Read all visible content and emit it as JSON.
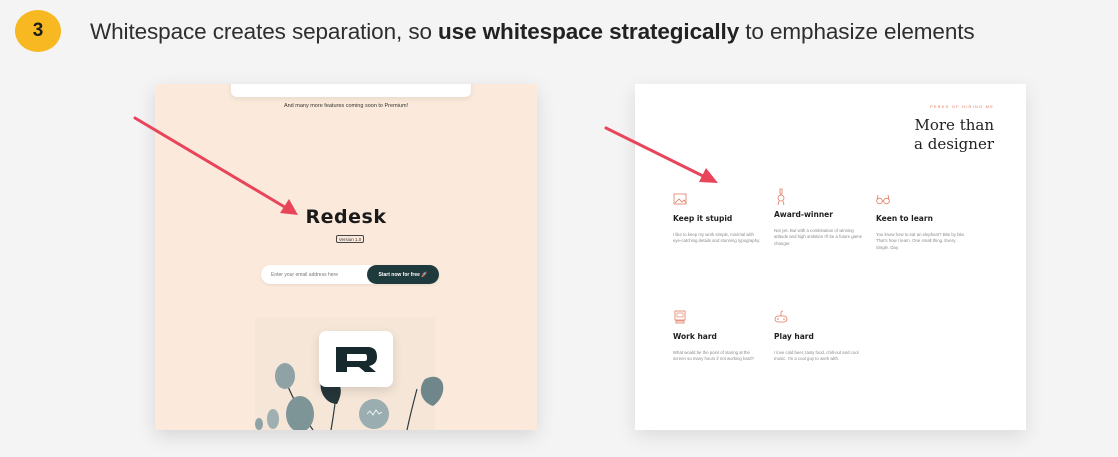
{
  "header": {
    "step_number": "3",
    "headline_prefix": "Whitespace creates separation, so ",
    "headline_bold": "use whitespace strategically",
    "headline_suffix": " to emphasize elements",
    "badge_color": "#f7b821"
  },
  "left_example": {
    "features_note": "And many more features coming soon to Premium!",
    "brand_name": "Redesk",
    "version": "Version 1.0",
    "email_placeholder": "Enter your email address here",
    "cta_label": "Start now for free 🚀",
    "background_color": "#fbeadb",
    "accent_color": "#1f3a3d"
  },
  "right_example": {
    "eyebrow": "PERKS OF HIRING ME",
    "heading_line1": "More than",
    "heading_line2": "a designer",
    "accent_color": "#e07a5f",
    "features": [
      {
        "icon": "image-icon",
        "title": "Keep it stupid",
        "description": "I like to keep my work simple, minimal with eye-catching details and stunning typography."
      },
      {
        "icon": "award-icon",
        "title": "Award-winner",
        "description": "Not yet. But with a combination of winning attitude and high ambition I'll be a future game changer."
      },
      {
        "icon": "glasses-icon",
        "title": "Keen to learn",
        "description": "You know how to eat an elephant? Bite by bite. That's how I learn. One small thing. Every. Single. Day."
      },
      {
        "icon": "computer-icon",
        "title": "Work hard",
        "description": "What would be the point of staring at the screen so many hours if not working hard?"
      },
      {
        "icon": "gamepad-icon",
        "title": "Play hard",
        "description": "I love cold beer, tasty food, chill-out and cool music. I'm a cool guy to work with."
      }
    ]
  },
  "annotation_arrow_color": "#e8455a"
}
